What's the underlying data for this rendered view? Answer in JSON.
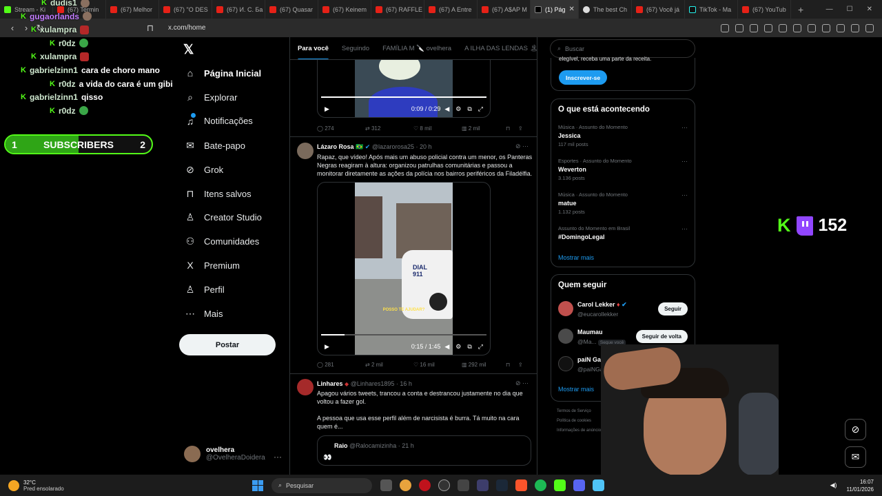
{
  "browser": {
    "tabs": [
      {
        "title": "Stream - Ki",
        "icon": "kick"
      },
      {
        "title": "(67) Termin",
        "icon": "youtube"
      },
      {
        "title": "(67) Melhor",
        "icon": "youtube"
      },
      {
        "title": "(67) \"O DES",
        "icon": "youtube"
      },
      {
        "title": "(67) И. С. Ба",
        "icon": "youtube"
      },
      {
        "title": "(67) Quasar",
        "icon": "youtube"
      },
      {
        "title": "(67) Keinem",
        "icon": "youtube"
      },
      {
        "title": "(67) RAFFLE",
        "icon": "youtube"
      },
      {
        "title": "(67) A Entre",
        "icon": "youtube"
      },
      {
        "title": "(67) A$AP M",
        "icon": "youtube"
      },
      {
        "title": "(1) Pág",
        "icon": "x",
        "active": true
      },
      {
        "title": "The best Ch",
        "icon": "chatgpt"
      },
      {
        "title": "(67) Você já",
        "icon": "youtube"
      },
      {
        "title": "TikTok - Ma",
        "icon": "tiktok"
      },
      {
        "title": "(67) YouTub",
        "icon": "youtube"
      }
    ],
    "url": "x.com/home"
  },
  "nav": {
    "items": [
      {
        "label": "Página Inicial",
        "icon": "home-icon",
        "glyph": "⌂"
      },
      {
        "label": "Explorar",
        "icon": "search-icon",
        "glyph": "⌕"
      },
      {
        "label": "Notificações",
        "icon": "bell-icon",
        "glyph": "♫"
      },
      {
        "label": "Bate-papo",
        "icon": "mail-icon",
        "glyph": "✉"
      },
      {
        "label": "Grok",
        "icon": "grok-icon",
        "glyph": "⊘"
      },
      {
        "label": "Itens salvos",
        "icon": "bookmark-icon",
        "glyph": "⊓"
      },
      {
        "label": "Creator Studio",
        "icon": "creator-icon",
        "glyph": "♙"
      },
      {
        "label": "Comunidades",
        "icon": "communities-icon",
        "glyph": "⚇"
      },
      {
        "label": "Premium",
        "icon": "x-premium-icon",
        "glyph": "X"
      },
      {
        "label": "Perfil",
        "icon": "profile-icon",
        "glyph": "♙"
      },
      {
        "label": "Mais",
        "icon": "more-icon",
        "glyph": "⋯"
      }
    ],
    "post_button": "Postar",
    "account": {
      "name": "ovelhera",
      "handle": "@OvelheraDoidera"
    }
  },
  "timeline": {
    "tabs": [
      "Para você",
      "Seguindo",
      "FAMÍLIA M 🔪 ovelhera",
      "A ILHA DAS LENDAS 🏝"
    ],
    "post1": {
      "video_time": "0:09 / 0:29",
      "progress": 1.0,
      "replies": "274",
      "reposts": "312",
      "likes": "8 mil",
      "views": "2 mil"
    },
    "post2": {
      "name": "Lázaro Rosa",
      "flag": "🇧🇷",
      "handle": "@lazarorosa25 · 20 h",
      "text": "Rapaz, que vídeo! Após mais um abuso policial contra um menor, os Panteras Negras reagiram à altura: organizou patrulhas comunitárias e passou a monitorar diretamente as ações da polícia nos bairros periféricos da Filadélfia.",
      "video_caption": "POSSO TE AJUDAR?",
      "car_text": "DIAL 911",
      "video_time": "0:15 / 1:45",
      "progress": 0.143,
      "replies": "281",
      "reposts": "2 mil",
      "likes": "16 mil",
      "views": "292 mil"
    },
    "post3": {
      "name": "Linhares",
      "handle": "@Linhares1895 · 16 h",
      "text1": "Apagou vários tweets, trancou a conta e destrancou justamente no dia que voltou a fazer gol.",
      "text2": "A pessoa que usa esse perfil além de narcisista é burra. Tá muito na cara quem é...",
      "quote_name": "Raio",
      "quote_handle": "@Ralocamizinha · 21 h",
      "quote_text": "👀"
    }
  },
  "right": {
    "search_placeholder": "Buscar",
    "premium_cut_text": "elegível, receba uma parte da receita.",
    "subscribe_label": "Inscrever-se",
    "trends_title": "O que está acontecendo",
    "trends": [
      {
        "meta": "Música · Assunto do Momento",
        "name": "Jessica",
        "count": "117 mil posts"
      },
      {
        "meta": "Esportes · Assunto do Momento",
        "name": "Weverton",
        "count": "3.136 posts"
      },
      {
        "meta": "Música · Assunto do Momento",
        "name": "matue",
        "count": "1.132 posts"
      },
      {
        "meta": "Assunto do Momento em Brasil",
        "name": "#DomingoLegal",
        "count": ""
      }
    ],
    "show_more": "Mostrar mais",
    "follow_title": "Quem seguir",
    "follows": [
      {
        "name": "Carol Lekker",
        "handle": "@eucarollekker",
        "button": "Seguir",
        "tag": ""
      },
      {
        "name": "Maumau",
        "handle": "@Ma...",
        "button": "Seguir de volta",
        "tag": "Segue você"
      },
      {
        "name": "paiN Gaming",
        "handle": "@paiNGamingBR",
        "button": "",
        "tag": ""
      }
    ],
    "show_more_2": "Mostrar mais",
    "footer": [
      "Termos de Serviço",
      "Política de cookies",
      "Informações de anúncios"
    ]
  },
  "stream": {
    "chat": [
      {
        "user": "dudis1",
        "msg": "",
        "emote": "face",
        "color": "#cfe8cf"
      },
      {
        "user": "gugaorlands",
        "msg": "",
        "emote": "face",
        "color": "#c37dff"
      },
      {
        "user": "xulampra",
        "msg": "",
        "emote": "red",
        "color": "#cfe8cf"
      },
      {
        "user": "r0dz",
        "msg": "",
        "emote": "green",
        "color": "#cfe8cf"
      },
      {
        "user": "xulampra",
        "msg": "",
        "emote": "red",
        "color": "#cfe8cf"
      },
      {
        "user": "gabrielzinn1",
        "msg": "cara de choro mano",
        "emote": "",
        "color": "#cfe8cf"
      },
      {
        "user": "r0dz",
        "msg": "a vida do cara é um gibi",
        "emote": "",
        "color": "#cfe8cf"
      },
      {
        "user": "gabrielzinn1",
        "msg": "qisso",
        "emote": "",
        "color": "#cfe8cf"
      },
      {
        "user": "r0dz",
        "msg": "",
        "emote": "green",
        "color": "#cfe8cf"
      }
    ],
    "sub_goal": {
      "label": "SUBSCRIBERS",
      "current": "1",
      "target": "2",
      "progress": 0.5
    },
    "viewers": "152"
  },
  "taskbar": {
    "temperature": "32°C",
    "weather": "Pred ensolarado",
    "search_placeholder": "Pesquisar",
    "time": "16:07",
    "date": "11/01/2026"
  },
  "colors": {
    "accent": "#1d9bf0",
    "kick": "#53fc18",
    "twitch": "#9146ff"
  }
}
